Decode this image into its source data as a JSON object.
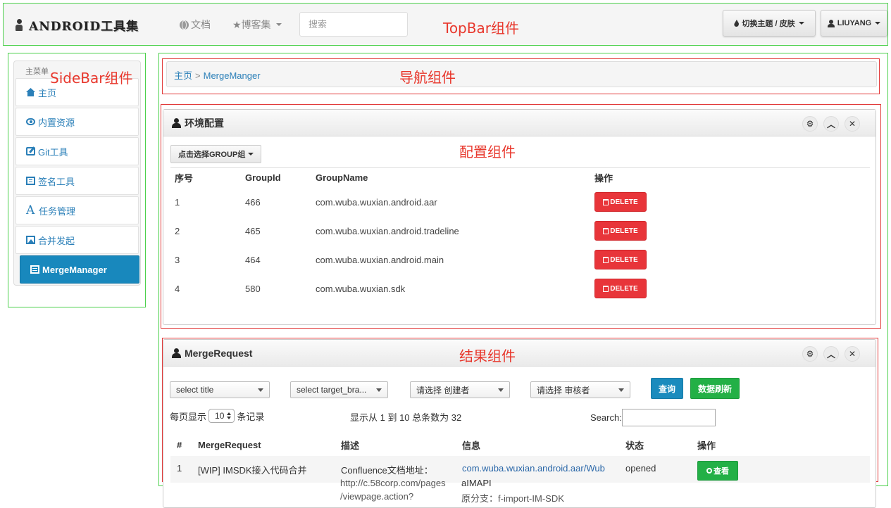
{
  "topbar": {
    "brand": "ANDROID工具集",
    "nav_doc": "文档",
    "nav_blog": "★博客集",
    "search_placeholder": "搜索",
    "theme_btn": "切换主题 / 皮肤",
    "user_btn": "LIUYANG",
    "annotation": "TopBar组件"
  },
  "sidebar": {
    "title": "主菜单",
    "annotation": "SideBar组件",
    "items": [
      {
        "label": "主页",
        "icon": "home-icon"
      },
      {
        "label": "内置资源",
        "icon": "eye-icon"
      },
      {
        "label": "Git工具",
        "icon": "edit-icon"
      },
      {
        "label": "签名工具",
        "icon": "list-icon"
      },
      {
        "label": "任务管理",
        "icon": "font-icon"
      },
      {
        "label": "合并发起",
        "icon": "picture-icon"
      },
      {
        "label": "MergeManager",
        "icon": "calendar-icon",
        "active": true
      }
    ]
  },
  "breadcrumb": {
    "home": "主页",
    "sep": ">",
    "current": "MergeManger",
    "annotation": "导航组件"
  },
  "config_panel": {
    "title": "环境配置",
    "annotation": "配置组件",
    "group_btn": "点击选择GROUP组",
    "tools": {
      "settings": "⚙",
      "collapse": "︿",
      "close": "✕"
    },
    "columns": [
      "序号",
      "GroupId",
      "GroupName",
      "操作"
    ],
    "rows": [
      {
        "no": "1",
        "group_id": "466",
        "group_name": "com.wuba.wuxian.android.aar"
      },
      {
        "no": "2",
        "group_id": "465",
        "group_name": "com.wuba.wuxian.android.tradeline"
      },
      {
        "no": "3",
        "group_id": "464",
        "group_name": "com.wuba.wuxian.android.main"
      },
      {
        "no": "4",
        "group_id": "580",
        "group_name": "com.wuba.wuxian.sdk"
      }
    ],
    "delete_label": "DELETE"
  },
  "merge_panel": {
    "title": "MergeRequest",
    "annotation": "结果组件",
    "filters": {
      "title": "select title",
      "target_branch": "select target_bra...",
      "creator": "请选择 创建者",
      "reviewer": "请选择 审核者"
    },
    "query_btn": "查询",
    "refresh_btn": "数据刷新",
    "page_size_prefix": "每页显示",
    "page_size": "10",
    "page_size_suffix": "条记录",
    "info": "显示从 1 到 10 总条数为 32",
    "search_label": "Search:",
    "columns": [
      "#",
      "MergeRequest",
      "描述",
      "信息",
      "状态",
      "操作"
    ],
    "row": {
      "no": "1",
      "title": "[WIP] IMSDK接入代码合并",
      "desc_line1": "Confluence文档地址：",
      "desc_line2": "http://c.58corp.com/pages",
      "desc_line3": "/viewpage.action?",
      "info_line1": "com.wuba.wuxian.android.aar/Wub",
      "info_line2": "aIMAPI",
      "info_line3": "原分支：f-import-IM-SDK",
      "status": "opened",
      "view_btn": "查看"
    }
  }
}
